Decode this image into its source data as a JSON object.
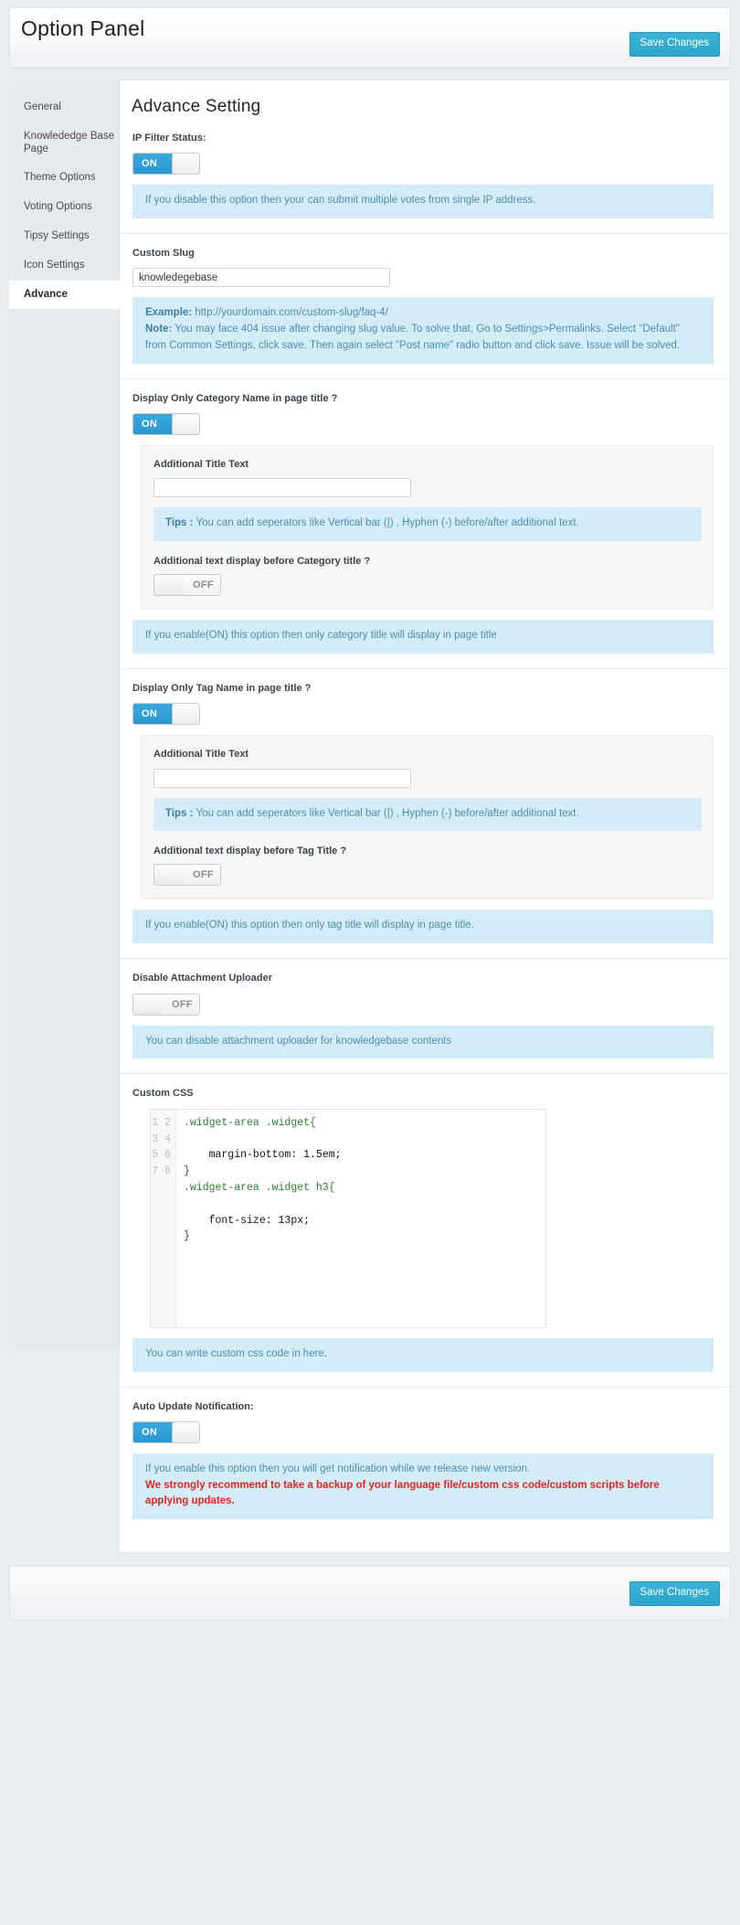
{
  "header": {
    "title": "Option Panel",
    "save_label": "Save Changes"
  },
  "sidebar": {
    "items": [
      {
        "label": "General",
        "active": false
      },
      {
        "label": "Knowlededge Base Page",
        "active": false
      },
      {
        "label": "Theme Options",
        "active": false
      },
      {
        "label": "Voting Options",
        "active": false
      },
      {
        "label": "Tipsy Settings",
        "active": false
      },
      {
        "label": "Icon Settings",
        "active": false
      },
      {
        "label": "Advance",
        "active": true
      }
    ]
  },
  "main": {
    "title": "Advance Setting",
    "ip_filter": {
      "label": "IP Filter Status:",
      "toggle_state": "ON",
      "info": "If you disable this option then your can submit multiple votes from single IP address."
    },
    "custom_slug": {
      "label": "Custom Slug",
      "value": "knowledegebase",
      "example_bold": "Example:",
      "example_text": " http://yourdomain.com/custom-slug/faq-4/",
      "note_bold": "Note:",
      "note_text": " You may face 404 issue after changing slug value. To solve that, Go to Settings>Permalinks. Select \"Default\" from Common Settings, click save. Then again select \"Post name\" radio button and click save. Issue will be solved."
    },
    "category_title": {
      "label": "Display Only Category Name in page title ?",
      "toggle_state": "ON",
      "additional_title_label": "Additional Title Text",
      "additional_title_value": "",
      "tips_bold": "Tips :",
      "tips_text": " You can add seperators like Vertical bar (|) , Hyphen (-) before/after additional text.",
      "before_label": "Additional text display before Category title ?",
      "before_toggle_state": "OFF",
      "info": "If you enable(ON) this option then only category title will display in page title"
    },
    "tag_title": {
      "label": "Display Only Tag Name in page title ?",
      "toggle_state": "ON",
      "additional_title_label": "Additional Title Text",
      "additional_title_value": "",
      "tips_bold": "Tips :",
      "tips_text": " You can add seperators like Vertical bar (|) , Hyphen (-) before/after additional text.",
      "before_label": "Additional text display before Tag Title ?",
      "before_toggle_state": "OFF",
      "info": "If you enable(ON) this option then only tag title will display in page title."
    },
    "attachment": {
      "label": "Disable Attachment Uploader",
      "toggle_state": "OFF",
      "info": "You can disable attachment uploader for knowledgebase contents"
    },
    "custom_css": {
      "label": "Custom CSS",
      "line_numbers": "1\n2\n3\n4\n5\n6\n7\n8",
      "code_line_1": ".widget-area .widget{",
      "code_line_2": "",
      "code_line_3": "    margin-bottom: 1.5em;",
      "code_line_4": "}",
      "code_line_5": ".widget-area .widget h3{",
      "code_line_6": "",
      "code_line_7": "    font-size: 13px;",
      "code_line_8": "}",
      "info": "You can write custom css code in here."
    },
    "auto_update": {
      "label": "Auto Update Notification:",
      "toggle_state": "ON",
      "info": "If you enable this option then you will get notification while we release new version.",
      "warning": "We strongly recommend to take a backup of your language file/custom css code/custom scripts before applying updates."
    }
  },
  "footer": {
    "save_label": "Save Changes"
  },
  "colors": {
    "accent": "#2da5cc",
    "toggle_on": "#3aa8dd",
    "info_bg": "#d4ecf7",
    "info_text": "#4b8fab",
    "warning_text": "#e2241f",
    "sidebar_bg": "#e6eaee",
    "page_bg": "#e9edf0"
  }
}
